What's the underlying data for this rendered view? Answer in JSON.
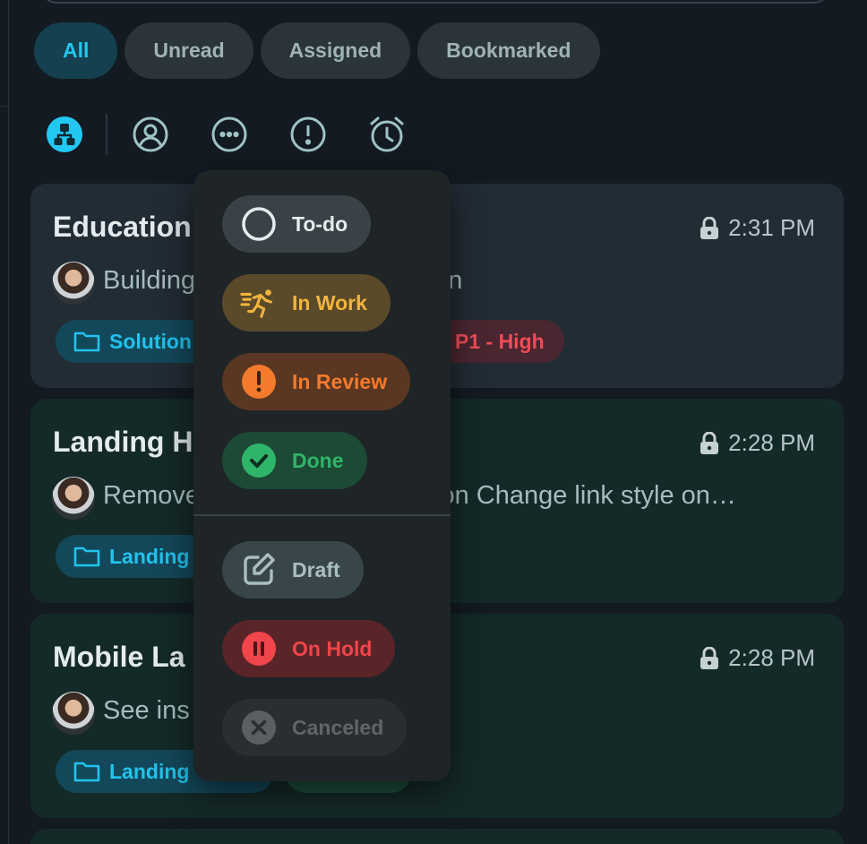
{
  "filters": {
    "all": "All",
    "unread": "Unread",
    "assigned": "Assigned",
    "bookmarked": "Bookmarked"
  },
  "toolbar": {
    "icons": [
      "org-chart-icon",
      "user-circle-icon",
      "more-horizontal-icon",
      "alert-circle-icon",
      "alarm-clock-icon"
    ]
  },
  "cards": [
    {
      "title": "Education",
      "time": "2:31 PM",
      "desc_left": "Building",
      "desc_right": "n",
      "folder_tag": "Solution",
      "priority_tag": "P1 - High"
    },
    {
      "title": "Landing H",
      "time": "2:28 PM",
      "desc_left": "Remove",
      "desc_right": "ion Change link style on…",
      "folder_tag": "Landing"
    },
    {
      "title": "Mobile La",
      "time": "2:28 PM",
      "desc_left": "See ins",
      "folder_tag": "Landing"
    }
  ],
  "status_menu": {
    "todo": "To-do",
    "in_work": "In Work",
    "in_review": "In Review",
    "done": "Done",
    "draft": "Draft",
    "on_hold": "On Hold",
    "canceled": "Canceled"
  },
  "colors": {
    "accent": "#23c6ef",
    "in_work": "#f2b43c",
    "in_review": "#f47a2c",
    "done": "#2fb56a",
    "on_hold": "#f0454a",
    "priority_high": "#ef4c58"
  }
}
